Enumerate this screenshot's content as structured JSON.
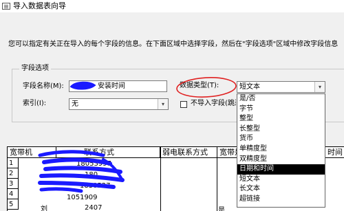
{
  "window": {
    "title": "导入数据表向导"
  },
  "instructions": "您可以指定有关正在导入的每个字段的信息。在下面区域中选择字段，然后在\"字段选项\"区域中修改字段信息",
  "field_options": {
    "group_label": "字段选项",
    "field_name_label": "字段名称(M):",
    "field_name_value": "安装时间",
    "data_type_label": "数据类型(T):",
    "data_type_value": "短文本",
    "index_label": "索引(I):",
    "index_value": "无",
    "skip_label": "不导入字段(跳过"
  },
  "data_type_options": [
    "是/否",
    "字节",
    "整型",
    "长整型",
    "货币",
    "单精度型",
    "双精度型",
    "日期和时间",
    "短文本",
    "长文本",
    "超链接"
  ],
  "selected_option_index": 7,
  "table": {
    "headers": [
      "宽带机",
      "联系方式",
      "弱电联系方式",
      "宽带是",
      "时间"
    ],
    "row_numbers": [
      "1",
      "2",
      "3",
      "4",
      "5"
    ],
    "cells": [
      "18053997",
      "180",
      "1830527",
      "1051909",
      "2407"
    ],
    "row5_col1": "刘",
    "row5_col3": "是"
  },
  "colors": {
    "selection": "#000000",
    "annotation_circle": "#e02020",
    "scribble": "#1a1aff"
  }
}
